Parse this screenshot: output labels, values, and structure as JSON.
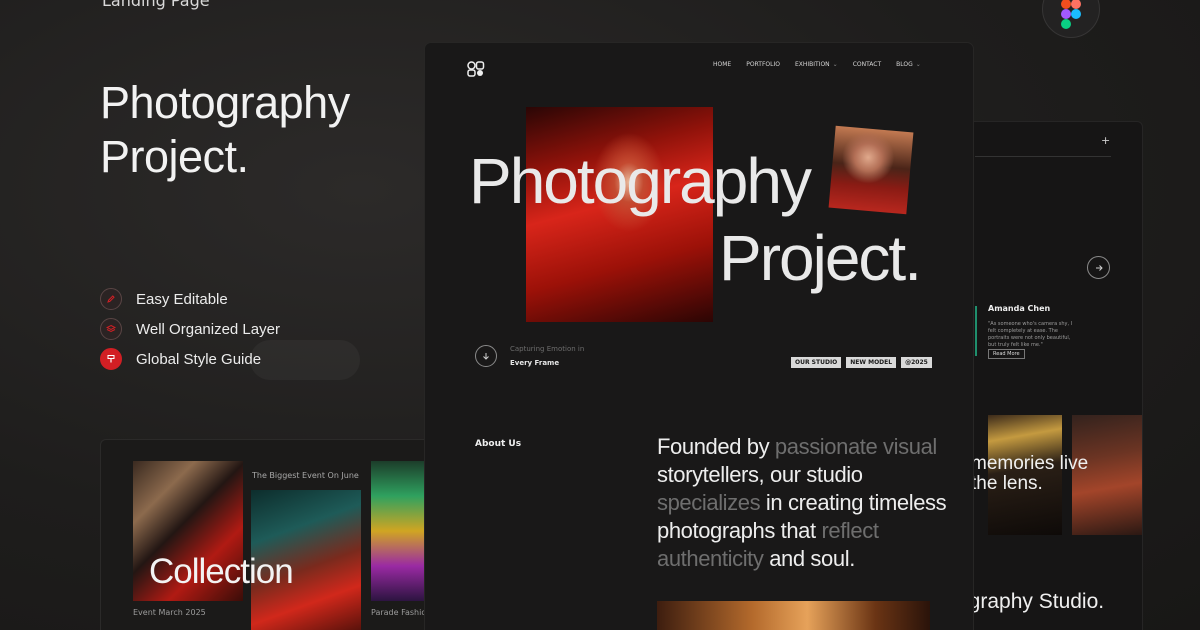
{
  "promo": {
    "top_label": "Landing Page",
    "title_line1": "Photography",
    "title_line2": "Project.",
    "features": [
      {
        "label": "Easy Editable",
        "icon": "pencil-icon"
      },
      {
        "label": "Well Organized Layer",
        "icon": "layers-icon"
      },
      {
        "label": "Global Style Guide",
        "icon": "style-guide-icon"
      }
    ],
    "accent_color": "#d21f24"
  },
  "main_mockup": {
    "nav": {
      "items": [
        {
          "label": "HOME"
        },
        {
          "label": "PORTFOLIO"
        },
        {
          "label": "EXHIBITION",
          "chevron": "chevron-down-icon"
        },
        {
          "label": "CONTACT"
        },
        {
          "label": "BLOG",
          "chevron": "chevron-down-icon"
        }
      ]
    },
    "hero": {
      "title_line1": "Photography",
      "title_line2": "Project.",
      "caption_sub": "Capturing Emotion in",
      "caption_main": "Every Frame",
      "tags": [
        "OUR STUDIO",
        "NEW MODEL",
        "@2025"
      ]
    },
    "about": {
      "heading": "About Us",
      "statement": [
        {
          "text": "Founded by ",
          "dim": false
        },
        {
          "text": "passionate visual",
          "dim": true
        },
        {
          "text": " storytellers, our studio ",
          "dim": false
        },
        {
          "text": "specializes",
          "dim": true
        },
        {
          "text": " in creating timeless photographs that ",
          "dim": false
        },
        {
          "text": "reflect authenticity",
          "dim": true
        },
        {
          "text": " and soul.",
          "dim": false
        }
      ]
    }
  },
  "right_mockup": {
    "plus": "+",
    "testimonial": {
      "name": "Amanda Chen",
      "quote": "\"As someone who's camera shy, I felt completely at ease. The portraits were not only beautiful, but truly felt like me.\"",
      "button": "Read More",
      "accent_color": "#1f8f6d"
    },
    "memories_text": "memories live\nthe lens.",
    "studio_text": "ography Studio."
  },
  "bottom_mockup": {
    "event_top": "The Biggest Event On June",
    "collection": "Collection",
    "event_date": "Event March 2025",
    "parade": "Parade Fashio"
  }
}
